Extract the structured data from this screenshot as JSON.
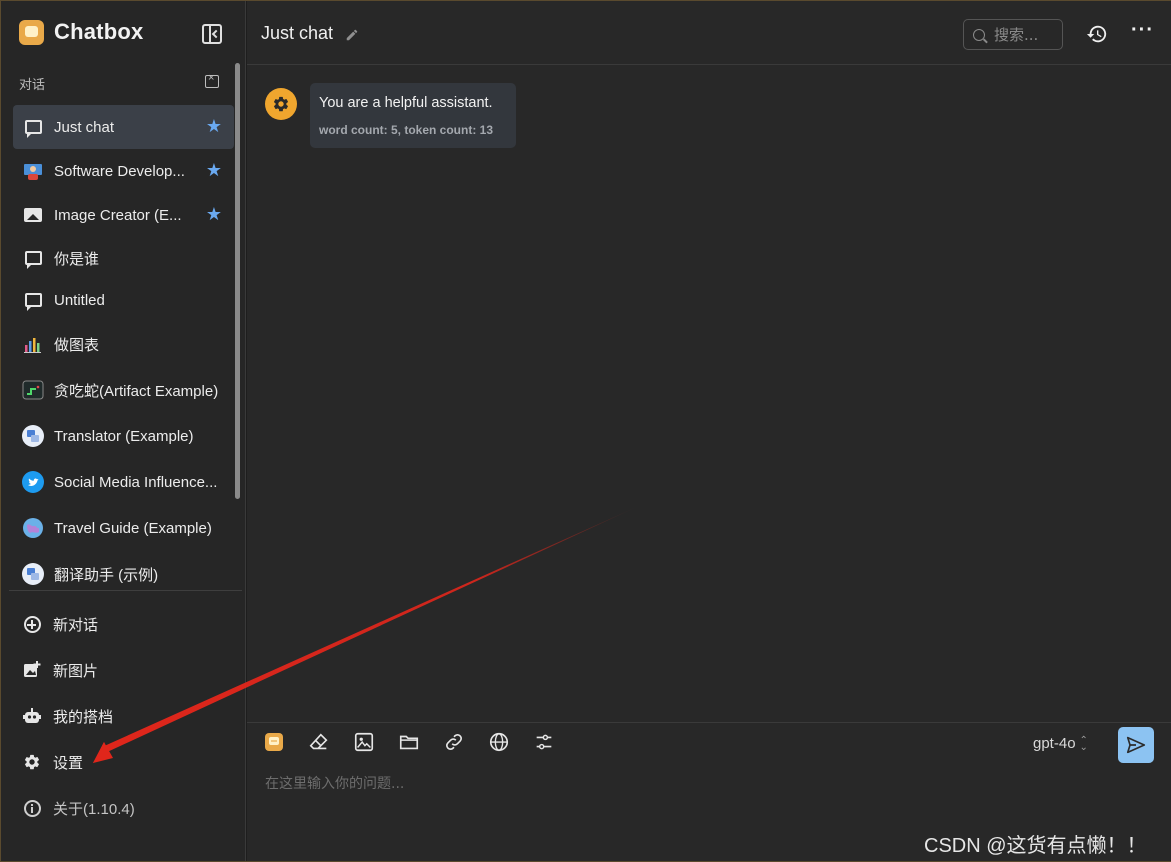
{
  "sidebar": {
    "brand": "Chatbox",
    "section_label": "对话",
    "conversations": [
      {
        "label": "Just chat",
        "starred": true,
        "active": true,
        "icon": "chat-bubble-icon"
      },
      {
        "label": "Software Developer (Example)",
        "display": "Software Develop...",
        "starred": true,
        "icon": "developer-avatar-icon"
      },
      {
        "label": "Image Creator (Example)",
        "display": "Image Creator (E...",
        "starred": true,
        "icon": "image-icon"
      },
      {
        "label": "你是谁",
        "icon": "chat-bubble-icon"
      },
      {
        "label": "Untitled",
        "icon": "chat-bubble-icon"
      },
      {
        "label": "做图表",
        "icon": "chart-avatar-icon"
      },
      {
        "label": "贪吃蛇(Artifact Example)",
        "icon": "snake-avatar-icon"
      },
      {
        "label": "Translator (Example)",
        "icon": "translator-avatar-icon"
      },
      {
        "label": "Social Media Influencer (Example)",
        "display": "Social Media Influence...",
        "icon": "twitter-avatar-icon"
      },
      {
        "label": "Travel Guide (Example)",
        "icon": "globe-avatar-icon"
      },
      {
        "label": "翻译助手 (示例)",
        "icon": "translator-avatar-icon"
      }
    ],
    "menu": {
      "new_chat": "新对话",
      "new_image": "新图片",
      "my_copilots": "我的搭档",
      "settings": "设置",
      "about": "关于(1.10.4)"
    }
  },
  "header": {
    "title": "Just chat",
    "search_placeholder": "搜索..."
  },
  "messages": [
    {
      "role": "system",
      "text": "You are a helpful assistant.",
      "meta": "word count: 5, token count: 13"
    }
  ],
  "composer": {
    "placeholder": "在这里输入你的问题...",
    "model": "gpt-4o"
  },
  "watermark": "CSDN @这货有点懒！！",
  "colors": {
    "accent_blue": "#8cc3f2",
    "star_blue": "#6aa9f0",
    "system_avatar": "#f0a62e",
    "annotation_arrow": "#e0261b"
  }
}
